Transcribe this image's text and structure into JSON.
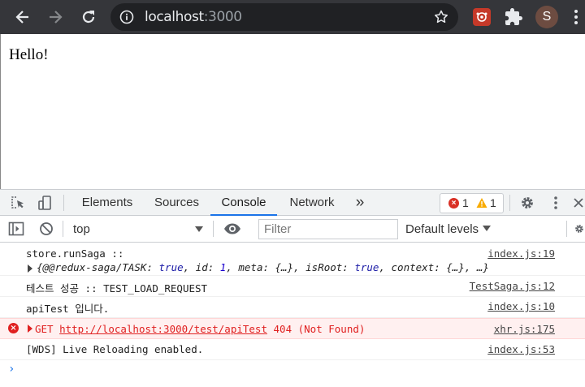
{
  "browser": {
    "url_host": "localhost",
    "url_port": ":3000",
    "avatar_letter": "S",
    "icons": {
      "back": "arrow-left-icon",
      "forward": "arrow-right-icon",
      "reload": "reload-icon",
      "site_info": "info-icon",
      "bookmark": "star-icon",
      "extension": "redux-extension-icon",
      "extensions": "puzzle-icon",
      "menu": "kebab-menu-icon"
    }
  },
  "page": {
    "text": "Hello!"
  },
  "devtools": {
    "tabs": [
      {
        "label": "Elements",
        "active": false
      },
      {
        "label": "Sources",
        "active": false
      },
      {
        "label": "Console",
        "active": true
      },
      {
        "label": "Network",
        "active": false
      }
    ],
    "more_tabs": "»",
    "error_count": "1",
    "warning_count": "1",
    "context": "top",
    "filter_placeholder": "Filter",
    "levels_label": "Default levels",
    "accent_color": "#1a73e8",
    "error_color": "#e02020"
  },
  "console": {
    "messages": [
      {
        "type": "log",
        "text": "store.runSaga ::",
        "source": "index.js:19",
        "object": {
          "open": "{@@redux-saga/TASK: ",
          "task_val": "true",
          "id_key": ", id: ",
          "id_val": "1",
          "meta": ", meta: {…}, isRoot: ",
          "root_val": "true",
          "rest": ", context: {…}, …}"
        }
      },
      {
        "type": "log",
        "text": "테스트 성공 ::  TEST_LOAD_REQUEST",
        "source": "TestSaga.js:12"
      },
      {
        "type": "log",
        "text": "apiTest 입니다.",
        "source": "index.js:10"
      },
      {
        "type": "error",
        "method": "GET",
        "url": "http://localhost:3000/test/apiTest",
        "status": "404 (Not Found)",
        "source": "xhr.js:175"
      },
      {
        "type": "log",
        "text": "[WDS] Live Reloading enabled.",
        "source": "index.js:53"
      }
    ],
    "prompt": "›"
  }
}
